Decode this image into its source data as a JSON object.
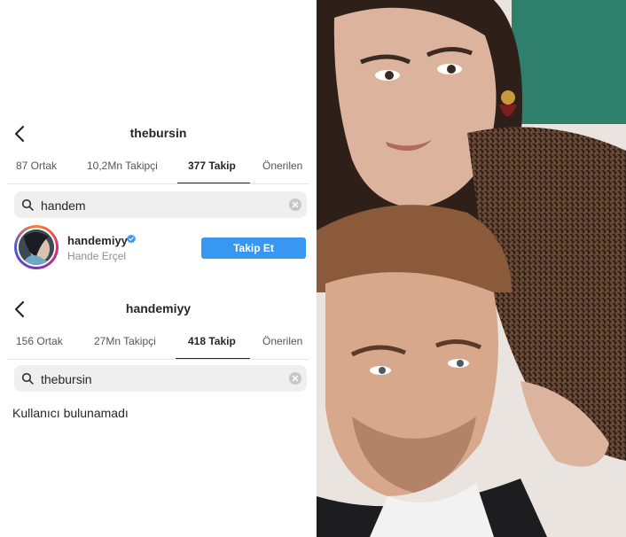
{
  "top_profile": {
    "username": "thebursin",
    "tabs": [
      {
        "label": "87 Ortak"
      },
      {
        "label": "10,2Mn Takipçi"
      },
      {
        "label": "377 Takip"
      },
      {
        "label": "Önerilen"
      }
    ],
    "active_tab": "377 Takip",
    "search_value": "handem",
    "result": {
      "username": "handemiyy",
      "full_name": "Hande Erçel",
      "verified": true,
      "button_label": "Takip Et"
    }
  },
  "bottom_profile": {
    "username": "handemiyy",
    "tabs": [
      {
        "label": "156 Ortak"
      },
      {
        "label": "27Mn Takipçi"
      },
      {
        "label": "418 Takip"
      },
      {
        "label": "Önerilen"
      }
    ],
    "active_tab": "418 Takip",
    "search_value": "thebursin",
    "empty_message": "Kullanıcı bulunamadı"
  },
  "colors": {
    "button_blue": "#3897f0",
    "verified_blue": "#3897f0",
    "search_bg": "#efefef",
    "muted_text": "#8e8e8e"
  },
  "icons": [
    "back-arrow-icon",
    "search-icon",
    "clear-icon",
    "verified-badge-icon"
  ]
}
